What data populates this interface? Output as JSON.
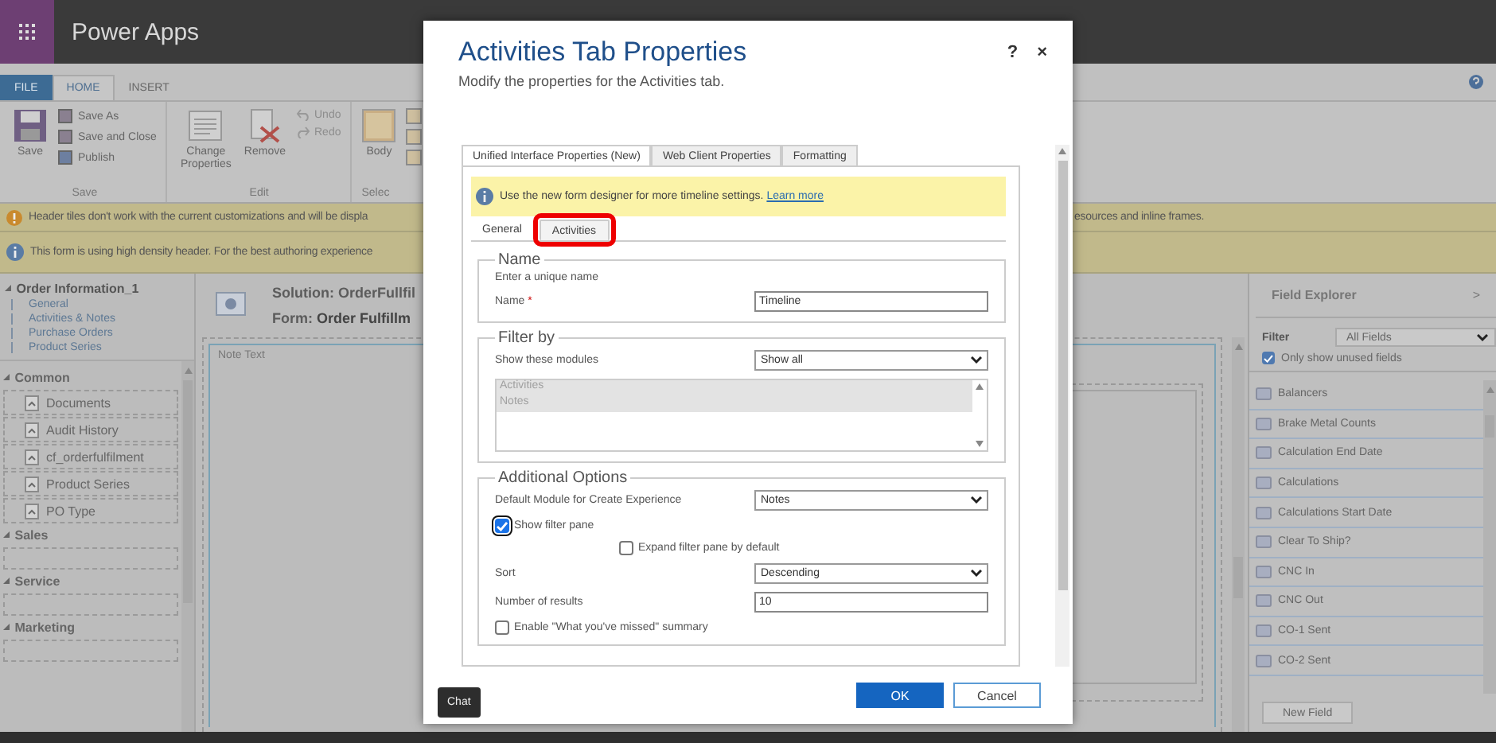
{
  "app_bar": {
    "title": "Power Apps"
  },
  "ribbon": {
    "tabs": [
      {
        "label": "FILE",
        "kind": "file",
        "selected": false
      },
      {
        "label": "HOME",
        "kind": "tab",
        "selected": true
      },
      {
        "label": "INSERT",
        "kind": "tab",
        "selected": false
      }
    ],
    "groups": [
      {
        "label": "Save",
        "large": [
          {
            "label": "Save"
          }
        ],
        "small": [
          {
            "label": "Save As",
            "disabled": false
          },
          {
            "label": "Save and Close",
            "disabled": false
          },
          {
            "label": "Publish",
            "disabled": false
          }
        ]
      },
      {
        "label": "Edit",
        "large": [
          {
            "label": "Change Properties"
          },
          {
            "label": "Remove"
          }
        ],
        "small": [
          {
            "label": "Undo",
            "disabled": true
          },
          {
            "label": "Redo",
            "disabled": true
          }
        ]
      },
      {
        "label": "Selec",
        "large": [
          {
            "label": "Body"
          }
        ]
      }
    ]
  },
  "notifications": [
    {
      "kind": "warning",
      "text": "Header tiles don't work with the current customizations and will be displa",
      "text_right": "esources and inline frames."
    },
    {
      "kind": "info",
      "text": "This form is using high density header. For the best authoring experience"
    }
  ],
  "navigation": {
    "title": "Order Information_1",
    "expanded": true,
    "children": [
      {
        "label": "General"
      },
      {
        "label": "Activities & Notes"
      },
      {
        "label": "Purchase Orders"
      },
      {
        "label": "Product Series"
      }
    ]
  },
  "components": [
    {
      "label": "Common",
      "expanded": true,
      "children": [
        {
          "label": "Documents"
        },
        {
          "label": "Audit History"
        },
        {
          "label": "cf_orderfulfilment"
        },
        {
          "label": "Product Series"
        },
        {
          "label": "PO Type"
        }
      ]
    },
    {
      "label": "Sales",
      "expanded": true
    },
    {
      "label": "Service",
      "expanded": true
    },
    {
      "label": "Marketing",
      "expanded": true
    }
  ],
  "form_header": {
    "solution": "Solution: OrderFullfil",
    "form": "Form: **Order Fulfillm**"
  },
  "canvas": {
    "field_label": "Note Text"
  },
  "field_explorer": {
    "title": "Field Explorer",
    "collapse": ">",
    "filter_label": "Filter",
    "filter_value": "All Fields",
    "unused_only": {
      "label": "Only show unused fields",
      "checked": true
    },
    "fields": [
      "Balancers",
      "Brake Metal Counts",
      "Calculation End Date",
      "Calculations",
      "Calculations Start Date",
      "Clear To Ship?",
      "CNC In",
      "CNC Out",
      "CO-1 Sent",
      "CO-2 Sent"
    ],
    "new_button": "New Field"
  },
  "dialog": {
    "title": "Activities Tab Properties",
    "subtitle": "Modify the properties for the Activities tab.",
    "help": "?",
    "close": "×",
    "tabs": [
      {
        "label": "Unified Interface Properties (New)",
        "selected": true
      },
      {
        "label": "Web Client Properties",
        "selected": false
      },
      {
        "label": "Formatting",
        "selected": false
      }
    ],
    "banner": {
      "text": "Use the new form designer for more timeline settings.",
      "link": "Learn more"
    },
    "subtabs": [
      {
        "label": "General",
        "selected": true,
        "highlighted": false
      },
      {
        "label": "Activities",
        "selected": false,
        "highlighted": true
      }
    ],
    "name_section": {
      "title": "Name",
      "hint": "Enter a unique name",
      "label": "Name",
      "required_mark": "*",
      "value": "Timeline"
    },
    "filter_section": {
      "title": "Filter by",
      "label": "Show these modules",
      "value": "Show all",
      "modules": [
        {
          "label": "Activities",
          "disabled": true
        },
        {
          "label": "Notes",
          "disabled": true
        }
      ]
    },
    "options_section": {
      "title": "Additional Options",
      "rows": [
        {
          "kind": "select",
          "label": "Default Module for Create Experience",
          "value": "Notes"
        },
        {
          "kind": "checkbox",
          "label": "Show filter pane",
          "checked": true,
          "focused": true,
          "indented": false
        },
        {
          "kind": "checkbox",
          "label": "Expand filter pane by default",
          "checked": false,
          "focused": false,
          "indented": true
        },
        {
          "kind": "select",
          "label": "Sort",
          "value": "Descending"
        },
        {
          "kind": "input",
          "label": "Number of results",
          "value": "10"
        },
        {
          "kind": "checkbox",
          "label": "Enable \"What you've missed\" summary",
          "checked": false,
          "focused": false,
          "indented": false
        }
      ]
    },
    "buttons": [
      {
        "label": "OK",
        "primary": true
      },
      {
        "label": "Cancel",
        "primary": false
      }
    ]
  },
  "chat": {
    "label": "Chat"
  }
}
